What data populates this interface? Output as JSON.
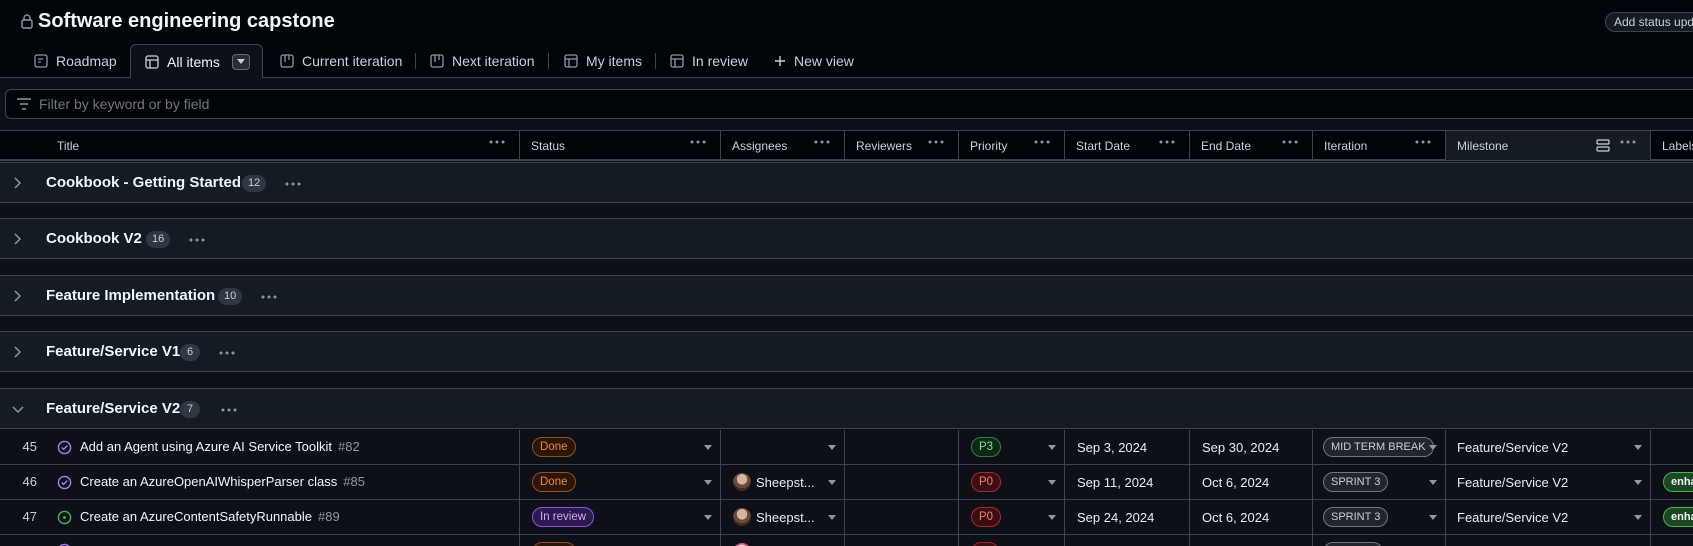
{
  "header": {
    "title": "Software engineering capstone",
    "status_update": "Add status update"
  },
  "tabs": [
    {
      "label": "Roadmap",
      "icon": "roadmap-icon"
    },
    {
      "label": "All items",
      "icon": "table-icon"
    },
    {
      "label": "Current iteration",
      "icon": "board-icon"
    },
    {
      "label": "Next iteration",
      "icon": "board-icon"
    },
    {
      "label": "My items",
      "icon": "table-icon"
    },
    {
      "label": "In review",
      "icon": "table-icon"
    }
  ],
  "new_view": "New view",
  "filter": {
    "placeholder": "Filter by keyword or by field"
  },
  "columns": [
    "Title",
    "Status",
    "Assignees",
    "Reviewers",
    "Priority",
    "Start Date",
    "End Date",
    "Iteration",
    "Milestone",
    "Labels"
  ],
  "groups": [
    {
      "name": "Cookbook - Getting Started",
      "count": "12",
      "expanded": false
    },
    {
      "name": "Cookbook V2",
      "count": "16",
      "expanded": false
    },
    {
      "name": "Feature Implementation",
      "count": "10",
      "expanded": false
    },
    {
      "name": "Feature/Service V1",
      "count": "6",
      "expanded": false
    },
    {
      "name": "Feature/Service V2",
      "count": "7",
      "expanded": true
    }
  ],
  "rows": [
    {
      "num": "45",
      "state": "closed",
      "title": "Add an Agent using Azure AI Service Toolkit",
      "issue": "#82",
      "status": "Done",
      "assignee": "",
      "priority": "P3",
      "start": "Sep 3, 2024",
      "end": "Sep 30, 2024",
      "iteration": "MID TERM BREAK",
      "milestone": "Feature/Service V2",
      "label": ""
    },
    {
      "num": "46",
      "state": "closed",
      "title": "Create an AzureOpenAIWhisperParser class",
      "issue": "#85",
      "status": "Done",
      "assignee": "Sheepst...",
      "priority": "P0",
      "start": "Sep 11, 2024",
      "end": "Oct 6, 2024",
      "iteration": "SPRINT 3",
      "milestone": "Feature/Service V2",
      "label": "enha"
    },
    {
      "num": "47",
      "state": "open",
      "title": "Create an AzureContentSafetyRunnable",
      "issue": "#89",
      "status": "In review",
      "assignee": "Sheepst...",
      "priority": "P0",
      "start": "Sep 24, 2024",
      "end": "Oct 6, 2024",
      "iteration": "SPRINT 3",
      "milestone": "Feature/Service V2",
      "label": "enha"
    }
  ],
  "colors": {
    "accent": "#238636",
    "done": "#f0883e",
    "review": "#d2a8ff",
    "p0": "#ff7b72",
    "p3": "#7ee787"
  }
}
